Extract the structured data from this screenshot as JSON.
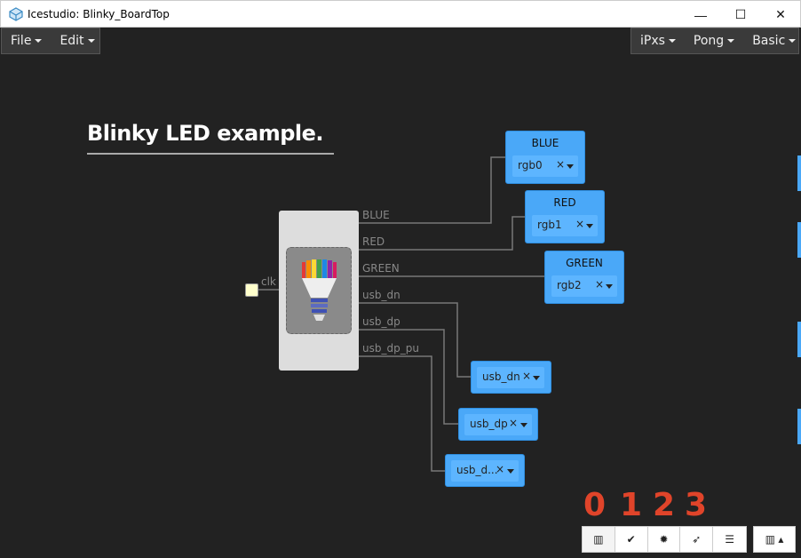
{
  "window": {
    "title": "Icestudio: Blinky_BoardTop",
    "min_glyph": "—",
    "max_glyph": "☐",
    "close_glyph": "✕"
  },
  "menu": {
    "left": [
      {
        "label": "File"
      },
      {
        "label": "Edit"
      }
    ],
    "right": [
      {
        "label": "iPxs"
      },
      {
        "label": "Pong"
      },
      {
        "label": "Basic"
      }
    ]
  },
  "design": {
    "heading": "Blinky LED example.",
    "module": {
      "input_label": "clk",
      "outputs": [
        "BLUE",
        "RED",
        "GREEN",
        "usb_dn",
        "usb_dp",
        "usb_dp_pu"
      ]
    },
    "pins": [
      {
        "name": "BLUE",
        "value": "rgb0"
      },
      {
        "name": "RED",
        "value": "rgb1"
      },
      {
        "name": "GREEN",
        "value": "rgb2"
      },
      {
        "name": "",
        "value": "usb_dn"
      },
      {
        "name": "",
        "value": "usb_dp"
      },
      {
        "name": "",
        "value": "usb_d..."
      }
    ],
    "clear_glyph": "×"
  },
  "steps": [
    "0",
    "1",
    "2",
    "3"
  ],
  "toolbar": {
    "buttons": [
      {
        "icon": "chip-icon",
        "glyph": "▥"
      },
      {
        "icon": "check-icon",
        "glyph": "✔"
      },
      {
        "icon": "gear-icon",
        "glyph": "✹"
      },
      {
        "icon": "rocket-icon",
        "glyph": "➶"
      },
      {
        "icon": "align-icon",
        "glyph": "☰"
      }
    ],
    "stats_glyph": "▥ ▴"
  },
  "colors": {
    "pin_blue": "#4aa8f8",
    "step_red": "#e0442a",
    "canvas_bg": "#222222"
  }
}
